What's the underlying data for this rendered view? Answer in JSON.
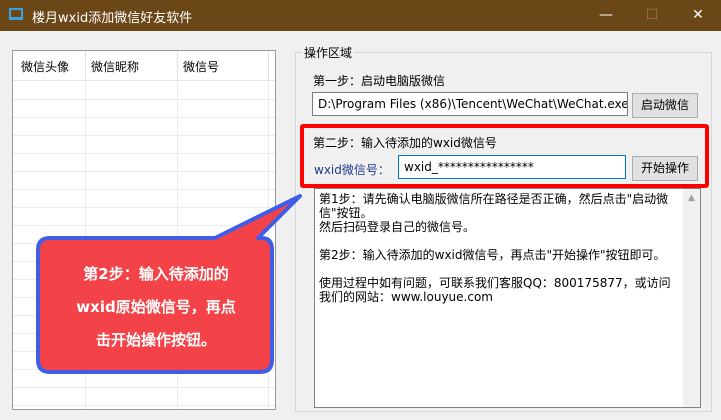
{
  "window": {
    "title": "楼月wxid添加微信好友软件",
    "minimize": "—",
    "maximize": "☐",
    "close": "✕"
  },
  "list": {
    "columns": [
      "微信头像",
      "微信昵称",
      "微信号"
    ]
  },
  "group": {
    "label": "操作区域",
    "step1_label": "第一步：启动电脑版微信",
    "path_value": "D:\\Program Files (x86)\\Tencent\\WeChat\\WeChat.exe",
    "launch_button": "启动微信",
    "step2_label": "第二步：输入待添加的wxid微信号",
    "wxid_label": "wxid微信号：",
    "wxid_value": "wxid_****************",
    "start_button": "开始操作"
  },
  "memo": {
    "lines": [
      "第1步：请先确认电脑版微信所在路径是否正确，然后点击\"启动微信\"按钮。",
      "然后扫码登录自己的微信号。",
      "第2步：输入待添加的wxid微信号，再点击\"开始操作\"按钮即可。",
      "使用过程中如有问题，可联系我们客服QQ：800175877，或访问我们的网站：www.louyue.com"
    ]
  },
  "callout": {
    "lines": [
      "第2步：输入待添加的",
      "wxid原始微信号，再点",
      "击开始操作按钮。"
    ],
    "fill": "#f44348",
    "border": "#3e5ee8"
  },
  "colors": {
    "titlebar": "#6b4718",
    "highlight": "#ff0000"
  }
}
